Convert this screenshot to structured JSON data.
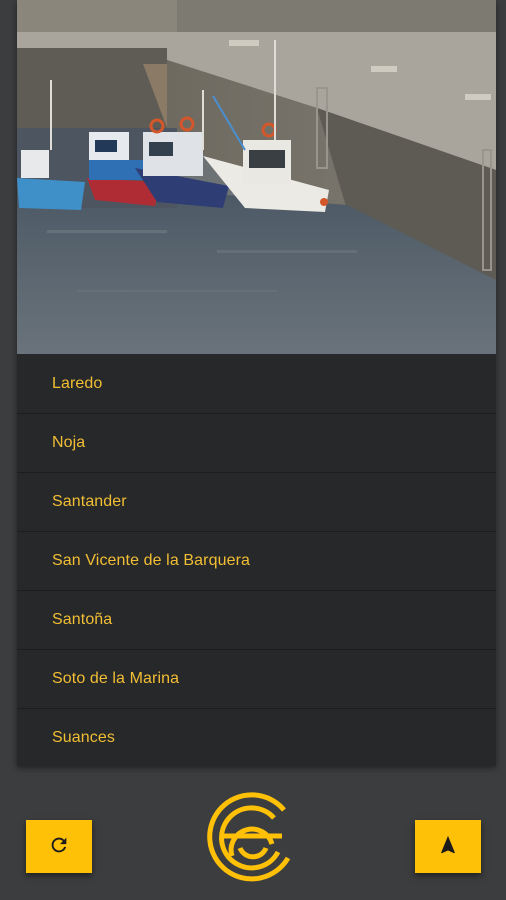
{
  "webcam": {
    "description_icon": "harbour-webcam-image"
  },
  "locations": [
    {
      "label": "Laredo"
    },
    {
      "label": "Noja"
    },
    {
      "label": "Santander"
    },
    {
      "label": "San Vicente de la Barquera"
    },
    {
      "label": "Santoña"
    },
    {
      "label": "Soto de la Marina"
    },
    {
      "label": "Suances"
    }
  ],
  "toolbar": {
    "refresh_icon": "refresh-icon",
    "logo_icon": "app-logo-icon",
    "locate_icon": "navigation-arrow-icon"
  },
  "colors": {
    "accent": "#ffc107",
    "list_text": "#f2be34",
    "list_bg": "#26282a",
    "app_bg": "#3b3d3f"
  }
}
